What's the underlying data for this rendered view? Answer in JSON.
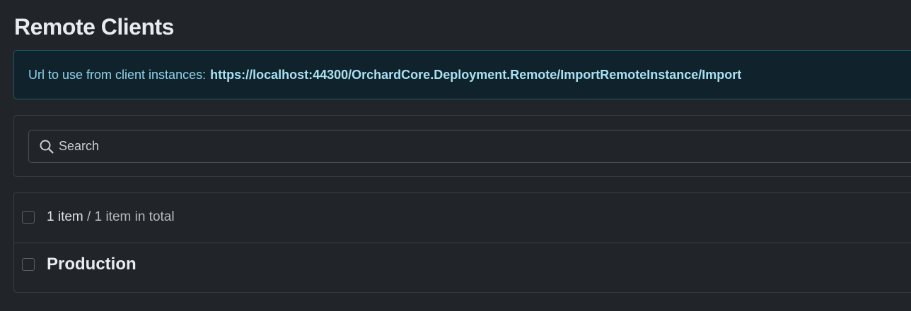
{
  "page": {
    "title": "Remote Clients"
  },
  "alert": {
    "label": "Url to use from client instances:",
    "url": "https://localhost:44300/OrchardCore.Deployment.Remote/ImportRemoteInstance/Import"
  },
  "search": {
    "placeholder": "Search",
    "value": "",
    "icon": "search-icon"
  },
  "list": {
    "summary_count": "1 item",
    "summary_separator": " / ",
    "summary_total": "1 item in total",
    "items": [
      {
        "name": "Production"
      }
    ]
  },
  "colors": {
    "background": "#212529",
    "alert_background": "#10232c",
    "alert_text": "#8fd3ea",
    "border": "#3a3f45"
  }
}
